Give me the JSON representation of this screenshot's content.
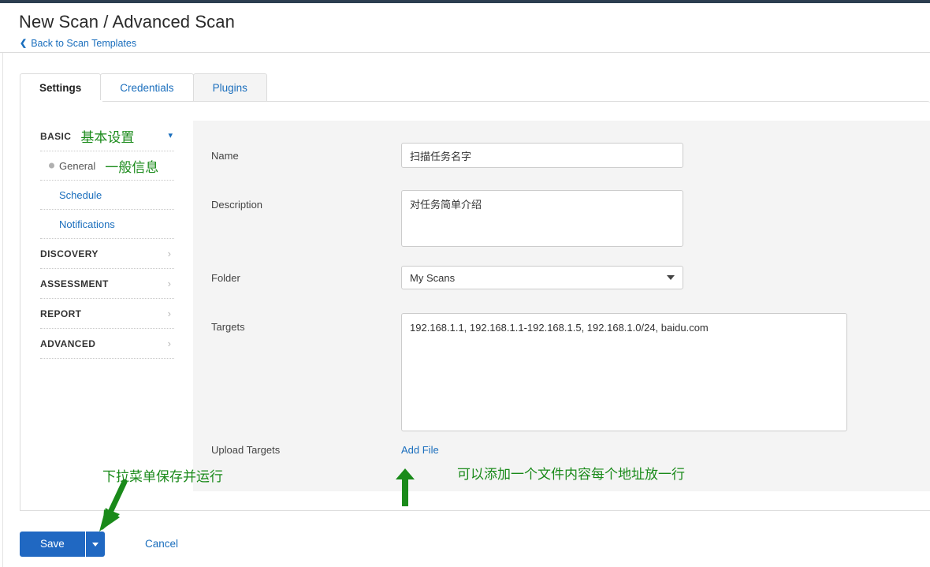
{
  "header": {
    "title": "New Scan / Advanced Scan",
    "back_link": "Back to Scan Templates",
    "back_icon": "chevron-left-icon"
  },
  "tabs": [
    {
      "label": "Settings",
      "state": "active"
    },
    {
      "label": "Credentials",
      "state": "default"
    },
    {
      "label": "Plugins",
      "state": "hovered"
    }
  ],
  "sidebar": {
    "sections": [
      {
        "label": "BASIC",
        "note": "基本设置",
        "expanded": true,
        "icon": "chevron-down-icon",
        "items": [
          {
            "label": "General",
            "note": "一般信息",
            "selected": true
          },
          {
            "label": "Schedule",
            "note": "",
            "selected": false
          },
          {
            "label": "Notifications",
            "note": "",
            "selected": false
          }
        ]
      },
      {
        "label": "DISCOVERY",
        "note": "",
        "expanded": false,
        "icon": "chevron-right-icon",
        "items": []
      },
      {
        "label": "ASSESSMENT",
        "note": "",
        "expanded": false,
        "icon": "chevron-right-icon",
        "items": []
      },
      {
        "label": "REPORT",
        "note": "",
        "expanded": false,
        "icon": "chevron-right-icon",
        "items": []
      },
      {
        "label": "ADVANCED",
        "note": "",
        "expanded": false,
        "icon": "chevron-right-icon",
        "items": []
      }
    ]
  },
  "form": {
    "name": {
      "label": "Name",
      "value": "扫描任务名字",
      "placeholder": ""
    },
    "description": {
      "label": "Description",
      "value": "对任务简单介绍",
      "placeholder": ""
    },
    "folder": {
      "label": "Folder",
      "value": "My Scans",
      "caret_icon": "caret-down-icon"
    },
    "targets": {
      "label": "Targets",
      "value": "192.168.1.1, 192.168.1.1-192.168.1.5, 192.168.1.0/24, baidu.com",
      "placeholder": ""
    },
    "upload_targets": {
      "label": "Upload Targets",
      "link_label": "Add File"
    }
  },
  "footer": {
    "save_label": "Save",
    "save_caret_icon": "caret-down-icon",
    "cancel_label": "Cancel"
  },
  "annotations": [
    {
      "id": "save-dropdown-note",
      "text": "下拉菜单保存并运行"
    },
    {
      "id": "add-file-note",
      "text": "可以添加一个文件内容每个地址放一行"
    }
  ],
  "colors": {
    "accent_blue": "#1a6ebd",
    "button_blue": "#2068c2",
    "annotation_green": "#1a8a1a",
    "panel_grey": "#f4f4f4",
    "topbar_dark": "#2c3e50"
  }
}
